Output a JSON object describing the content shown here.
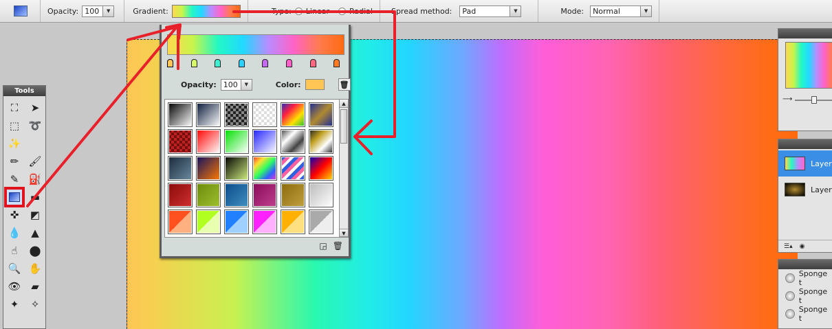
{
  "options_bar": {
    "opacity_label": "Opacity:",
    "opacity_value": "100",
    "gradient_label": "Gradient:",
    "type_label": "Type:",
    "type_linear": "Linear",
    "type_radial": "Radial",
    "spread_label": "Spread method:",
    "spread_value": "Pad",
    "mode_label": "Mode:",
    "mode_value": "Normal"
  },
  "tools": {
    "title": "Tools",
    "items": [
      {
        "name": "crop-tool",
        "icon": "crop-icon",
        "glyph": "⛶"
      },
      {
        "name": "move-tool",
        "icon": "move-arrow-icon",
        "glyph": "➤"
      },
      {
        "name": "marquee-tool",
        "icon": "marquee-icon",
        "glyph": "⬚"
      },
      {
        "name": "lasso-tool",
        "icon": "lasso-icon",
        "glyph": "➰"
      },
      {
        "name": "magic-wand-tool",
        "icon": "magic-wand-icon",
        "glyph": "✨"
      },
      {
        "name": "empty-slot",
        "icon": "",
        "glyph": ""
      },
      {
        "name": "pencil-tool",
        "icon": "pencil-icon",
        "glyph": "✏"
      },
      {
        "name": "brush-tool",
        "icon": "brush-icon",
        "glyph": "🖌"
      },
      {
        "name": "eraser-tool",
        "icon": "eraser-icon",
        "glyph": "✎"
      },
      {
        "name": "paint-bucket-tool",
        "icon": "paint-bucket-icon",
        "glyph": "⛽"
      },
      {
        "name": "gradient-tool",
        "icon": "gradient-icon",
        "glyph": "",
        "selected": true
      },
      {
        "name": "color-picker-tool",
        "icon": "color-picker-icon",
        "glyph": "▬"
      },
      {
        "name": "clone-tool",
        "icon": "clone-icon",
        "glyph": "✜"
      },
      {
        "name": "shape-tool",
        "icon": "shape-icon",
        "glyph": "◩"
      },
      {
        "name": "blur-tool",
        "icon": "drop-icon",
        "glyph": "💧"
      },
      {
        "name": "sharpen-tool",
        "icon": "sharpen-icon",
        "glyph": "▲"
      },
      {
        "name": "smudge-tool",
        "icon": "smudge-hand-icon",
        "glyph": "☝"
      },
      {
        "name": "sponge-tool",
        "icon": "sponge-icon",
        "glyph": "⬤"
      },
      {
        "name": "zoom-tool",
        "icon": "magnifier-icon",
        "glyph": "🔍"
      },
      {
        "name": "hand-tool",
        "icon": "hand-icon",
        "glyph": "✋"
      },
      {
        "name": "red-eye-tool",
        "icon": "eye-icon",
        "glyph": "👁"
      },
      {
        "name": "bandage-tool",
        "icon": "bandage-icon",
        "glyph": "▰"
      },
      {
        "name": "bloat-tool",
        "icon": "bloat-icon",
        "glyph": "✦"
      },
      {
        "name": "pinch-tool",
        "icon": "pinch-icon",
        "glyph": "✧"
      }
    ]
  },
  "gradient_editor": {
    "opacity_label": "Opacity:",
    "opacity_value": "100",
    "color_label": "Color:",
    "stop_colors": [
      "#ffc655",
      "#d6f86a",
      "#3ff0d0",
      "#2ad0ff",
      "#c46af0",
      "#ff60c8",
      "#ff6880",
      "#ff7a20"
    ],
    "presets": [
      "linear-gradient(135deg,#000,#fff)",
      "linear-gradient(135deg,#0a1a3a,#fff)",
      "repeating-conic-gradient(#888 0 25%,#222 0 50%) 0 0/8px 8px",
      "repeating-conic-gradient(#ddd 0 25%,#fff 0 50%) 0 0/8px 8px",
      "linear-gradient(135deg,#2030c0,#ff2040,#ffe000,#20c040)",
      "linear-gradient(135deg,#1a2a9a,#b08a30,#1a2a9a)",
      "repeating-conic-gradient(#c02020 0 25%,#701010 0 50%) 0 0/8px 8px",
      "linear-gradient(135deg,#ff0000,#fff)",
      "linear-gradient(135deg,#00e000,#fff)",
      "linear-gradient(135deg,#2020ff,#fff)",
      "linear-gradient(135deg,#444,#fff,#444,#fff)",
      "linear-gradient(135deg,#222,#c0a020,#fff,#222)",
      "linear-gradient(135deg,#1a2a3a,#6a8aa0)",
      "linear-gradient(135deg,#101060,#ff7a00)",
      "linear-gradient(135deg,#000,#d0f080)",
      "linear-gradient(135deg,#ff3030,#ffe030,#30ff60,#3060ff,#ff30d0)",
      "repeating-linear-gradient(135deg,#3060e0 0 5px,#ff60a0 5px 10px,#fff 10px 14px)",
      "linear-gradient(135deg,#0000c0,#ff0000,#ffe000)",
      "linear-gradient(135deg,#8a0a0a,#d03030)",
      "linear-gradient(135deg,#6a8a0a,#a0c030)",
      "linear-gradient(135deg,#0a4a8a,#4090c0)",
      "linear-gradient(135deg,#8a0a5a,#c04090)",
      "linear-gradient(135deg,#8a6a0a,#c0a040)",
      "linear-gradient(135deg,#bbb,#fff)",
      "linear-gradient(135deg,#ff5020 50%,#ffb080 50%)",
      "linear-gradient(135deg,#b0ff20 50%,#e8ffb0 50%)",
      "linear-gradient(135deg,#2080ff 50%,#a0d0ff 50%)",
      "linear-gradient(135deg,#ff20ff 50%,#ffb0ff 50%)",
      "linear-gradient(135deg,#ffb000 50%,#ffe080 50%)",
      "linear-gradient(135deg,#aaa 50%,#eee 50%)"
    ]
  },
  "right_panels": {
    "layers": [
      {
        "label": "Layer",
        "thumb": "linear-gradient(to right,#ffd84f,#23f8c4,#b88cff,#ff63c8)",
        "selected": true
      },
      {
        "label": "Layer",
        "thumb": "radial-gradient(#b08a30,#000)",
        "selected": false
      }
    ],
    "history": [
      "Sponge t",
      "Sponge t",
      "Sponge t"
    ]
  },
  "colors": {
    "annotation_red": "#e8202a",
    "selection_red": "#e0121b"
  }
}
